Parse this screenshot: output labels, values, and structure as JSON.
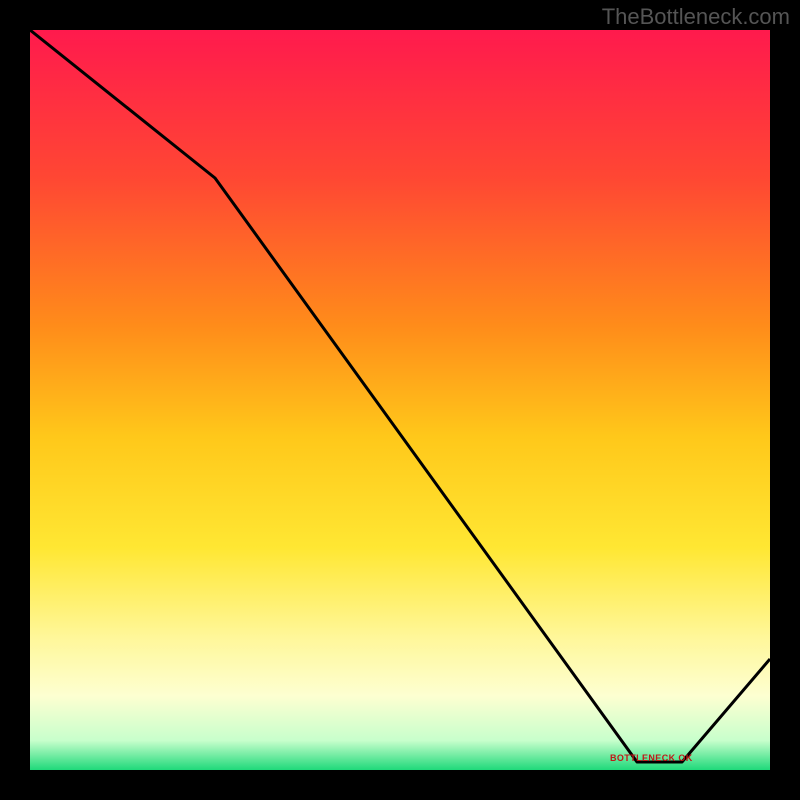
{
  "watermark": "TheBottleneck.com",
  "annotation_text": "BOTTLENECK OK",
  "chart_data": {
    "type": "line",
    "title": "",
    "xlabel": "",
    "ylabel": "",
    "xlim": [
      0,
      100
    ],
    "ylim": [
      0,
      100
    ],
    "x": [
      0,
      25,
      82,
      88,
      100
    ],
    "values": [
      100,
      80,
      1,
      1,
      15
    ],
    "gradient_stops": [
      {
        "pos": 0.0,
        "color": "#ff1a4d"
      },
      {
        "pos": 0.2,
        "color": "#ff4733"
      },
      {
        "pos": 0.4,
        "color": "#ff8c1a"
      },
      {
        "pos": 0.55,
        "color": "#ffc81a"
      },
      {
        "pos": 0.7,
        "color": "#ffe733"
      },
      {
        "pos": 0.82,
        "color": "#fff799"
      },
      {
        "pos": 0.9,
        "color": "#fdffd1"
      },
      {
        "pos": 0.96,
        "color": "#c8ffcc"
      },
      {
        "pos": 1.0,
        "color": "#1fd97a"
      }
    ],
    "ok_region": {
      "x_start": 80,
      "x_end": 90
    }
  }
}
